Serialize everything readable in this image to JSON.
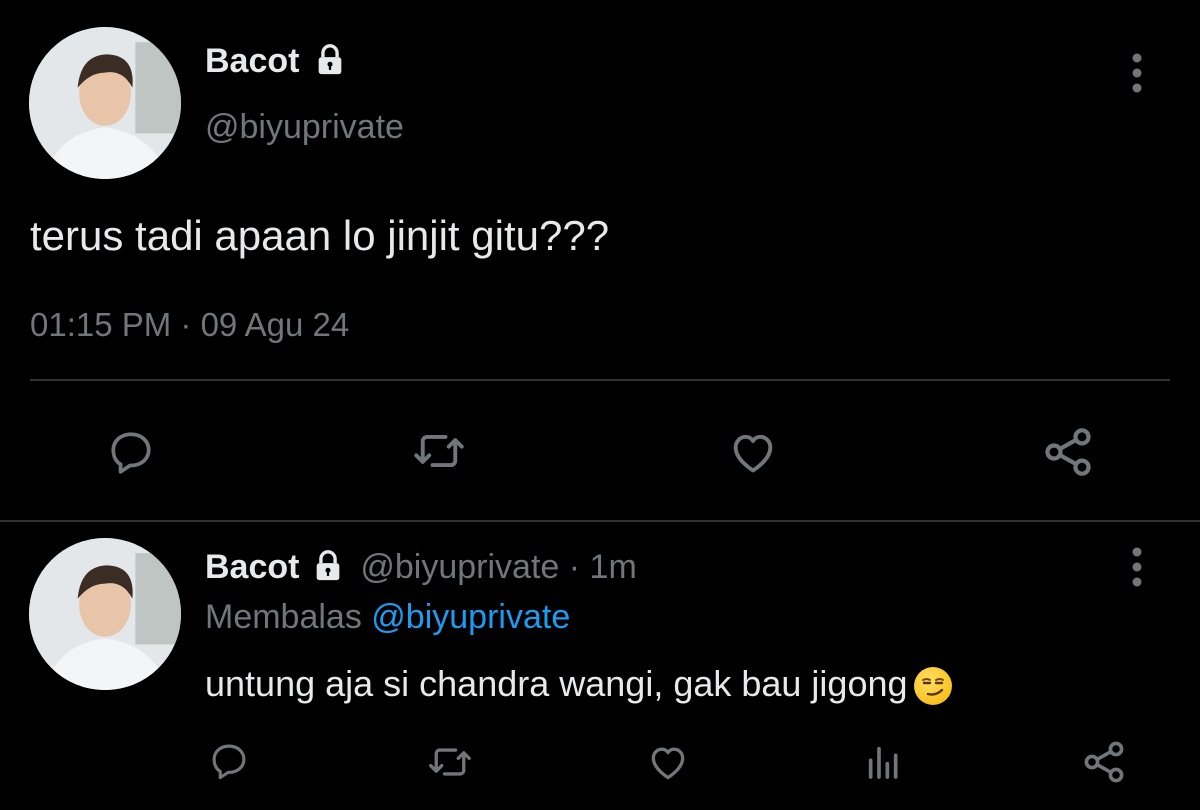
{
  "main_tweet": {
    "display_name": "Bacot",
    "handle": "@biyuprivate",
    "text": "terus tadi apaan lo jinjit gitu???",
    "timestamp": "01:15 PM · 09 Agu 24",
    "protected_icon": "lock-icon",
    "actions": [
      "reply-icon",
      "retweet-icon",
      "like-icon",
      "share-icon"
    ]
  },
  "reply_tweet": {
    "display_name": "Bacot",
    "handle": "@biyuprivate",
    "separator": "·",
    "time_ago": "1m",
    "replying_label": "Membalas",
    "replying_to": "@biyuprivate",
    "text": "untung aja si chandra wangi, gak bau jigong",
    "emoji": "smirking-face",
    "actions": [
      "reply-icon",
      "retweet-icon",
      "like-icon",
      "analytics-icon",
      "share-icon"
    ]
  },
  "colors": {
    "background": "#000000",
    "text": "#e7e9ea",
    "muted": "#71767b",
    "link": "#1d9bf0",
    "divider": "#2f3336"
  }
}
